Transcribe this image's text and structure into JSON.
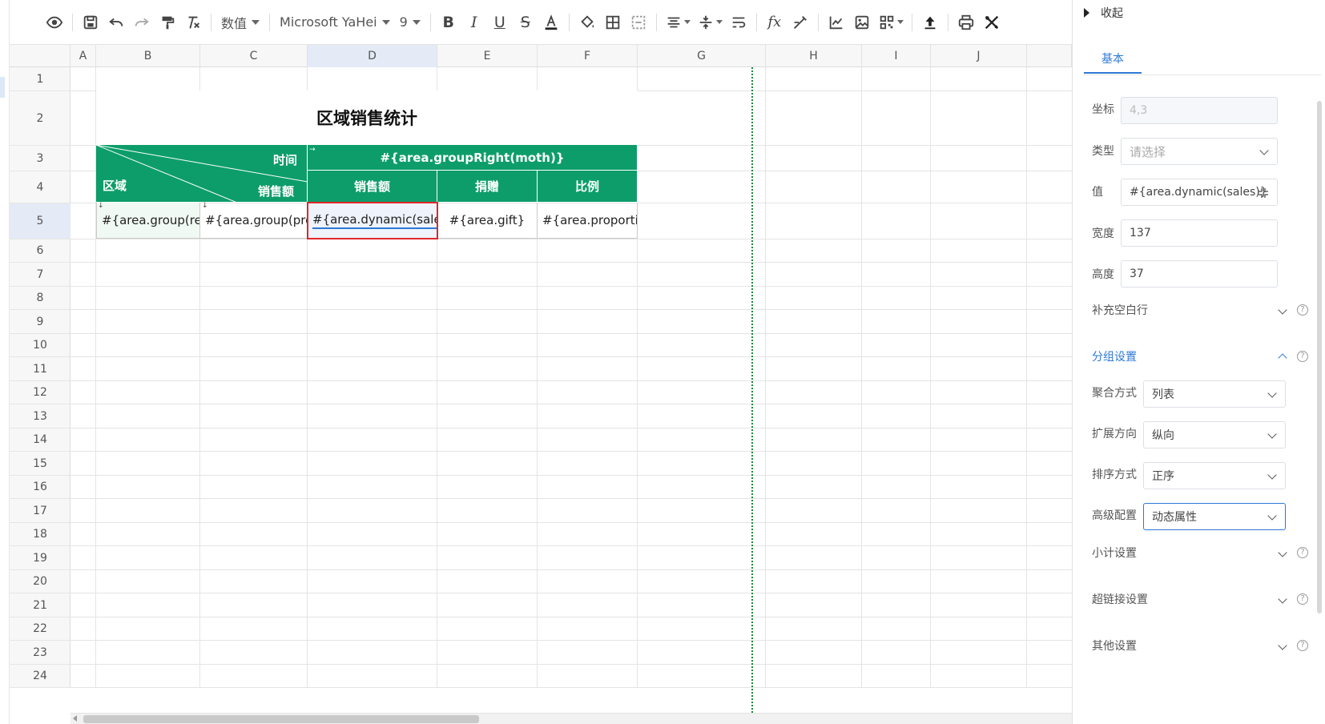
{
  "toolbar": {
    "number_format": "数值",
    "font_family": "Microsoft YaHei",
    "font_size": "9"
  },
  "columns": [
    "A",
    "B",
    "C",
    "D",
    "E",
    "F",
    "G",
    "H",
    "I",
    "J"
  ],
  "rows": [
    "1",
    "2",
    "3",
    "4",
    "5",
    "6",
    "7",
    "8",
    "9",
    "10",
    "11",
    "12",
    "13",
    "14",
    "15",
    "16",
    "17",
    "18",
    "19",
    "20",
    "21",
    "22",
    "23",
    "24"
  ],
  "selected_column": "D",
  "selected_row": "5",
  "sheet": {
    "title": "区域销售统计",
    "header_time": "时间",
    "header_region": "区域",
    "header_sales_diag": "销售额",
    "group_right": "#{area.groupRight(moth)}",
    "col_sales": "销售额",
    "col_gift": "捐赠",
    "col_ratio": "比例",
    "b5": "#{area.group(reg",
    "c5": "#{area.group(prov",
    "d5": "#{area.dynamic(sales)}",
    "e5": "#{area.gift}",
    "f5": "#{area.proportio"
  },
  "panel": {
    "collapse_label": "收起",
    "tab_basic": "基本",
    "coord_label": "坐标",
    "coord_value": "4,3",
    "type_label": "类型",
    "type_placeholder": "请选择",
    "value_label": "值",
    "value_value": "#{area.dynamic(sales)}",
    "width_label": "宽度",
    "width_value": "137",
    "height_label": "高度",
    "height_value": "37",
    "fill_blank": "补充空白行",
    "group_settings": "分组设置",
    "aggregate_label": "聚合方式",
    "aggregate_value": "列表",
    "expand_label": "扩展方向",
    "expand_value": "纵向",
    "sort_label": "排序方式",
    "sort_value": "正序",
    "advanced_label": "高级配置",
    "advanced_value": "动态属性",
    "subtotal": "小计设置",
    "hyperlink": "超链接设置",
    "other": "其他设置"
  },
  "colors": {
    "header_green": "#0d9d6b",
    "accent_blue": "#2e78d6",
    "selection_red": "#e0262b"
  }
}
